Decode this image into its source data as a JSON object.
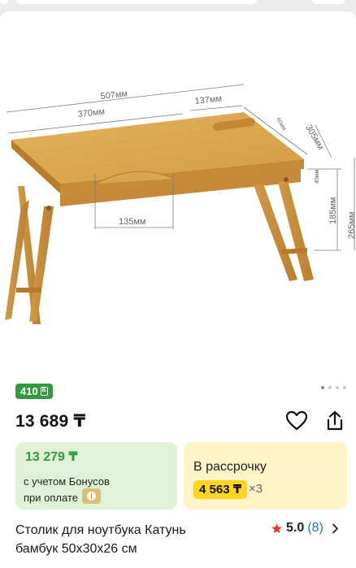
{
  "product": {
    "bonus_badge": "410",
    "bonus_icon": "Б",
    "price": "13 689 ₸",
    "title_line1": "Столик для ноутбука Катунь",
    "title_line2": "бамбук 50x30x26 см"
  },
  "dimensions": {
    "width_total": "507мм",
    "width_main": "370мм",
    "width_slot": "137мм",
    "slot_depth": "40мм",
    "depth": "305мм",
    "handle": "135мм",
    "drawer_h": "40мм",
    "leg_height": "185мм",
    "total_height": "265мм"
  },
  "gallery": {
    "count": 4,
    "active": 0
  },
  "bonus_offer": {
    "price": "13 279 ₸",
    "line1": "с учетом Бонусов",
    "line2": "при оплате"
  },
  "installment": {
    "title": "В рассрочку",
    "amount": "4 563 ₸",
    "multiplier": "×3"
  },
  "rating": {
    "value": "5.0",
    "count": "(8)"
  },
  "icons": {
    "favorite": "heart-icon",
    "share": "share-icon",
    "star": "star-icon",
    "chevron": "chevron-right-icon"
  },
  "colors": {
    "green": "#2e9c3a",
    "green_bg": "#dff2d6",
    "yellow_bg": "#fdf4c8",
    "yellow_chip": "#ffd51f",
    "star": "#e53935",
    "link": "#2a72c6"
  }
}
